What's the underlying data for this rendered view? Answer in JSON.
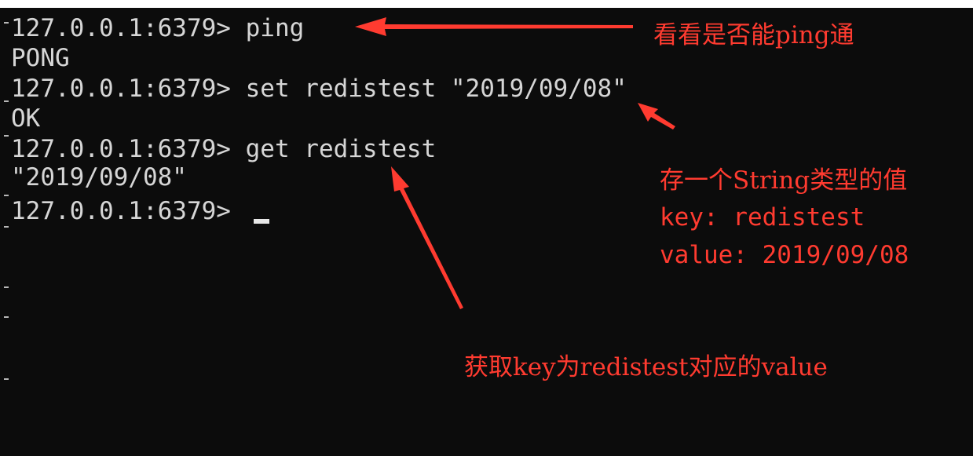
{
  "terminal": {
    "lines": [
      {
        "prompt": "127.0.0.1:6379> ",
        "command": "ping"
      },
      {
        "output": "PONG"
      },
      {
        "prompt": "127.0.0.1:6379> ",
        "command": "set redistest \"2019/09/08\""
      },
      {
        "output": "OK"
      },
      {
        "prompt": "127.0.0.1:6379> ",
        "command": "get redistest"
      },
      {
        "output": "\"2019/09/08\""
      },
      {
        "prompt": "127.0.0.1:6379> ",
        "command": ""
      }
    ]
  },
  "annotations": {
    "ping_note": "看看是否能ping通",
    "set_note": "存一个String类型的值",
    "set_key": "key: redistest",
    "set_value": "value: 2019/09/08",
    "get_note": "获取key为redistest对应的value"
  },
  "colors": {
    "terminal_bg": "#0c0c0c",
    "terminal_text": "#d6d6d6",
    "annotation": "#ff3b30"
  }
}
